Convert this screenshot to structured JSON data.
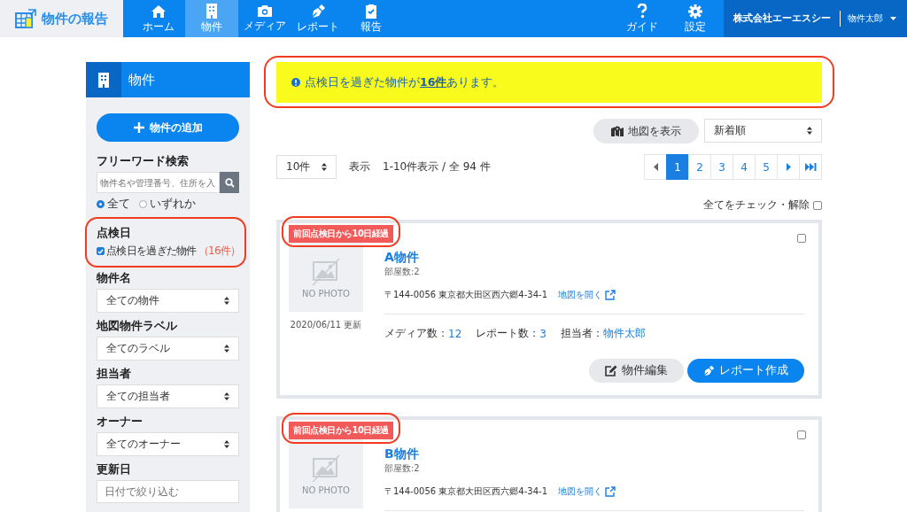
{
  "header": {
    "logo": "物件の報告",
    "nav": [
      {
        "label": "ホーム",
        "kind": "home",
        "selected": false
      },
      {
        "label": "物件",
        "kind": "building",
        "selected": true
      },
      {
        "label": "メディア",
        "kind": "camera",
        "selected": false
      },
      {
        "label": "レポート",
        "kind": "pen",
        "selected": false
      },
      {
        "label": "報告",
        "kind": "clipboard",
        "selected": false
      }
    ],
    "right_nav": [
      {
        "label": "ガイド",
        "kind": "question"
      },
      {
        "label": "設定",
        "kind": "gear"
      }
    ],
    "company": "株式会社エーエスシー",
    "user": "物件太郎"
  },
  "sidebar": {
    "title": "物件",
    "add_button": "物件の追加",
    "search": {
      "label": "フリーワード検索",
      "placeholder": "物件名や管理番号、住所を入"
    },
    "match": [
      {
        "label": "全て",
        "selected": true
      },
      {
        "label": "いずれか",
        "selected": false
      }
    ],
    "inspection": {
      "label": "点検日",
      "checkbox": "点検日を過ぎた物件",
      "count": "（16件）",
      "checked": true,
      "highlighted": true
    },
    "filters": [
      {
        "label": "物件名",
        "value": "全ての物件"
      },
      {
        "label": "地図物件ラベル",
        "value": "全てのラベル"
      },
      {
        "label": "担当者",
        "value": "全ての担当者"
      },
      {
        "label": "オーナー",
        "value": "全てのオーナー"
      }
    ],
    "date": {
      "label": "更新日",
      "placeholder": "日付で絞り込む"
    }
  },
  "alert": {
    "before": "点検日を過ぎた物件が",
    "link": "16件",
    "after": "あります。",
    "highlighted": true
  },
  "toolbar": {
    "map_button": "地図を表示",
    "sort": "新着順",
    "per_page": "10件",
    "per_page_label": "表示",
    "summary": "1-10件表示 / 全 94 件",
    "pages": [
      {
        "label": "1",
        "selected": true
      },
      {
        "label": "2",
        "selected": false
      },
      {
        "label": "3",
        "selected": false
      },
      {
        "label": "4",
        "selected": false
      },
      {
        "label": "5",
        "selected": false
      }
    ],
    "check_all": "全てをチェック・解除",
    "check_all_checked": false
  },
  "cards": [
    {
      "badge": "前回点検日から10日経過",
      "highlighted": true,
      "checked": false,
      "photo_placeholder": "NO PHOTO",
      "updated": "2020/06/11 更新",
      "title": "A物件",
      "rooms": "部屋数:2",
      "address": "〒144-0056 東京都大田区西六郷4-34-1",
      "map_link": "地図を開く",
      "media_label": "メディア数：",
      "media_count": "12",
      "report_label": "レポート数：",
      "report_count": "3",
      "staff_label": "担当者：",
      "staff": "物件太郎",
      "edit_button": "物件編集",
      "report_button": "レポート作成"
    },
    {
      "badge": "前回点検日から10日経過",
      "highlighted": true,
      "checked": false,
      "photo_placeholder": "NO PHOTO",
      "title": "B物件",
      "rooms": "部屋数:2",
      "address": "〒144-0056 東京都大田区西六郷4-34-1",
      "map_link": "地図を開く"
    }
  ]
}
